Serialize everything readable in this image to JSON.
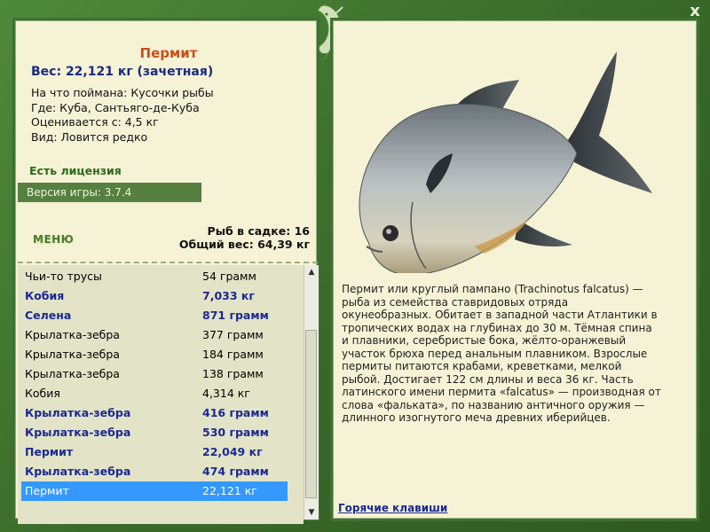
{
  "close_label": "x",
  "fish": {
    "name": "Пермит",
    "weight": "Вес: 22,121 кг (зачетная)",
    "caught_on": "На что поймана: Кусочки рыбы",
    "where": "Где: Куба, Сантьяго-де-Куба",
    "value": "Оценивается с: 4,5 кг",
    "kind": "Вид: Ловится редко"
  },
  "license": "Есть лицензия",
  "version": "Версия игры: 3.7.4",
  "menu_label": "МЕНЮ",
  "keep": {
    "count": "Рыб в садке: 16",
    "total": "Общий вес: 64,39 кг"
  },
  "catch_list": [
    {
      "name": "Чьи-то трусы",
      "weight": "54 грамм",
      "bold": false
    },
    {
      "name": "Кобия",
      "weight": "7,033 кг",
      "bold": true
    },
    {
      "name": "Селена",
      "weight": "871 грамм",
      "bold": true
    },
    {
      "name": "Крылатка-зебра",
      "weight": "377 грамм",
      "bold": false
    },
    {
      "name": "Крылатка-зебра",
      "weight": "184 грамм",
      "bold": false
    },
    {
      "name": "Крылатка-зебра",
      "weight": "138 грамм",
      "bold": false
    },
    {
      "name": "Кобия",
      "weight": "4,314 кг",
      "bold": false
    },
    {
      "name": "Крылатка-зебра",
      "weight": "416 грамм",
      "bold": true
    },
    {
      "name": "Крылатка-зебра",
      "weight": "530 грамм",
      "bold": true
    },
    {
      "name": "Пермит",
      "weight": "22,049 кг",
      "bold": true
    },
    {
      "name": "Крылатка-зебра",
      "weight": "474 грамм",
      "bold": true
    },
    {
      "name": "Пермит",
      "weight": "22,121 кг",
      "bold": false,
      "selected": true
    }
  ],
  "description": "Пермит или круглый пампано (Trachinotus falcatus) — рыба из семейства ставридовых отряда окунеобразных. Обитает в западной части Атлантики в тропических водах на глубинах до 30 м. Тёмная спина и плавники, серебристые бока, жёлто-оранжевый участок брюха перед анальным плавником. Взрослые пермиты питаются крабами, креветками, мелкой рыбой. Достигает 122 см длины и веса 36 кг. Часть латинского имени пермита «falcatus» — производная от слова «фальката», по названию античного оружия — длинного изогнутого меча древних иберийцев.",
  "hotkeys_label": "Горячие клавиши",
  "colors": {
    "title": "#c8501c",
    "bold_item": "#1a2a90",
    "selected": "#3399ff",
    "frame": "#3f7030"
  }
}
